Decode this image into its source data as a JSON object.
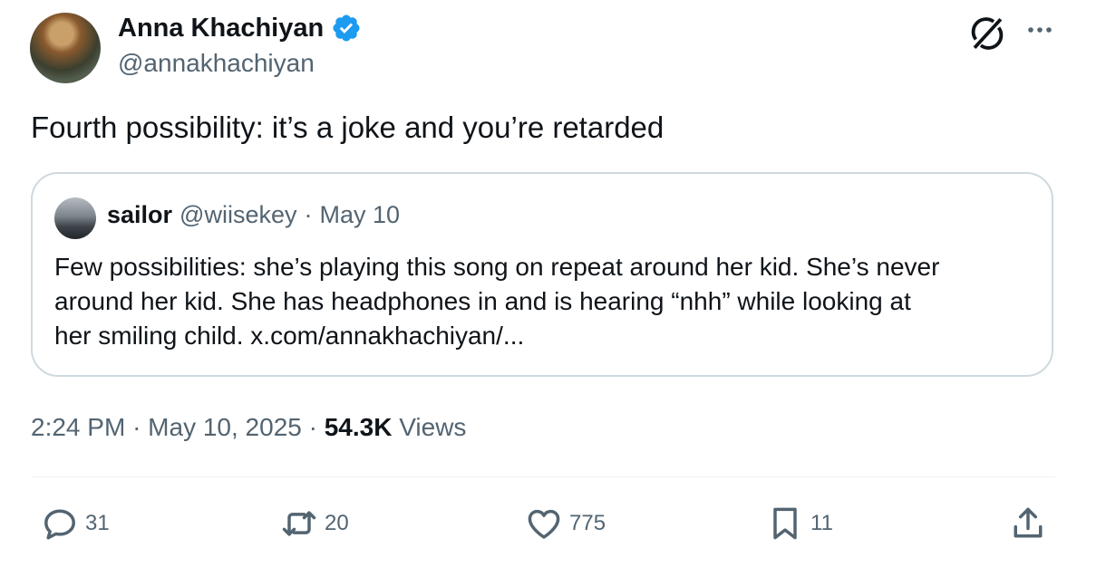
{
  "author": {
    "name": "Anna Khachiyan",
    "handle": "@annakhachiyan"
  },
  "tweet": {
    "text": "Fourth possibility: it’s a joke and you’re retarded"
  },
  "quoted": {
    "name": "sailor",
    "handle": "@wiisekey",
    "separator": "·",
    "date": "May 10",
    "lines": [
      "Few possibilities: she’s playing this song on repeat around her kid. She’s never",
      "around her kid. She has headphones in and is hearing “nhh” while looking at",
      "her smiling child. x.com/annakhachiyan/..."
    ]
  },
  "meta": {
    "time": "2:24 PM",
    "sep1": "·",
    "date": "May 10, 2025",
    "sep2": "·",
    "views_count": "54.3K",
    "views_label": "Views"
  },
  "actions": {
    "replies": "31",
    "reposts": "20",
    "likes": "775",
    "bookmarks": "11"
  },
  "icons": {
    "verified": "verified-badge-icon",
    "grok": "grok-icon",
    "more": "more-icon",
    "reply": "reply-icon",
    "repost": "repost-icon",
    "like": "heart-icon",
    "bookmark": "bookmark-icon",
    "share": "share-icon"
  },
  "colors": {
    "verified": "#1d9bf0",
    "text": "#0f1419",
    "secondary": "#536471",
    "border": "#cfd9de"
  }
}
